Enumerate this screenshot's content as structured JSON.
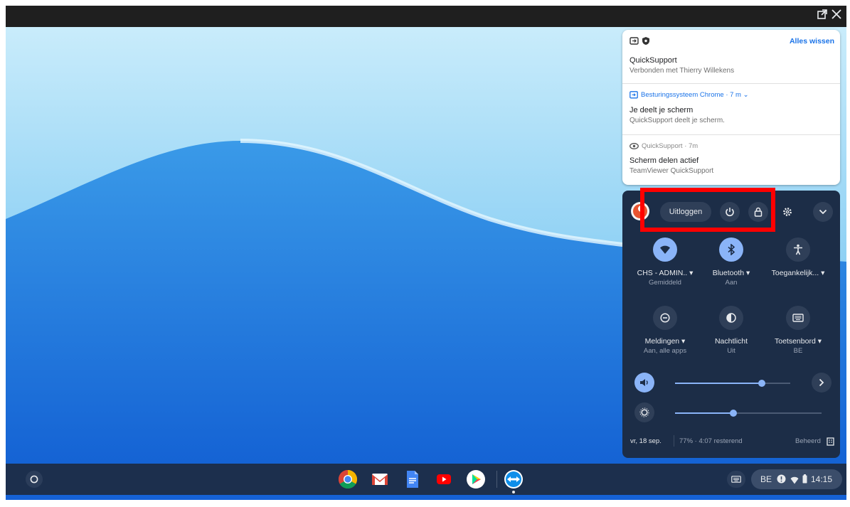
{
  "window": {
    "popout_icon": "popout-icon",
    "close_icon": "close-icon"
  },
  "notifications": {
    "clear_all": "Alles wissen",
    "items": [
      {
        "title": "QuickSupport",
        "body": "Verbonden met Thierry Willekens"
      },
      {
        "meta": "Besturingssysteem Chrome · 7 m ⌄",
        "title": "Je deelt je scherm",
        "body": "QuickSupport deelt je scherm."
      },
      {
        "meta": "QuickSupport · 7m",
        "title": "Scherm delen actief",
        "body": "TeamViewer QuickSupport"
      }
    ]
  },
  "quick_settings": {
    "signout": "Uitloggen",
    "tiles": [
      {
        "label": "CHS - ADMIN.. ▾",
        "sub": "Gemiddeld",
        "icon": "wifi-icon",
        "active": true
      },
      {
        "label": "Bluetooth ▾",
        "sub": "Aan",
        "icon": "bluetooth-icon",
        "active": true
      },
      {
        "label": "Toegankelijk... ▾",
        "sub": "",
        "icon": "accessibility-icon",
        "active": false
      },
      {
        "label": "Meldingen ▾",
        "sub": "Aan, alle apps",
        "icon": "notifications-icon",
        "active": false
      },
      {
        "label": "Nachtlicht",
        "sub": "Uit",
        "icon": "night-light-icon",
        "active": false
      },
      {
        "label": "Toetsenbord ▾",
        "sub": "BE",
        "icon": "keyboard-icon",
        "active": false
      }
    ],
    "volume_level": 0.75,
    "brightness_level": 0.4,
    "date": "vr, 18 sep.",
    "battery": "77% · 4:07 resterend",
    "managed": "Beheerd"
  },
  "shelf": {
    "apps": [
      "chrome-icon",
      "gmail-icon",
      "docs-icon",
      "youtube-icon",
      "play-store-icon",
      "teamviewer-icon"
    ],
    "ime": "BE",
    "time": "14:15"
  },
  "colors": {
    "accent": "#8ab4f8",
    "panel": "#1c2d47",
    "highlight": "#ff0000"
  }
}
